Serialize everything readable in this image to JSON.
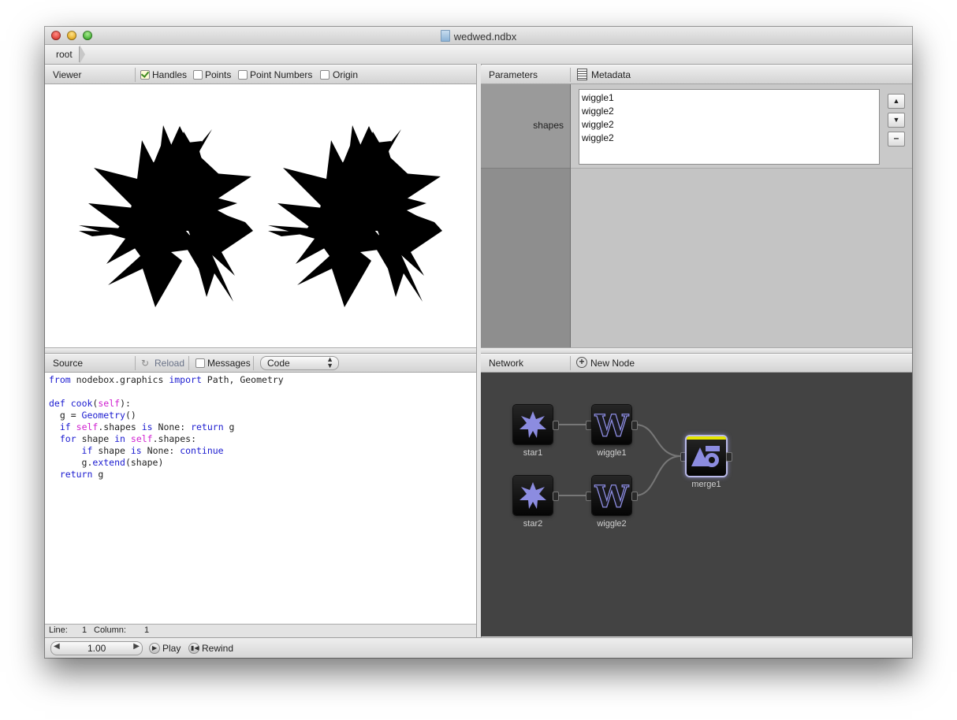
{
  "window": {
    "title": "wedwed.ndbx"
  },
  "breadcrumb": {
    "items": [
      "root"
    ]
  },
  "viewer": {
    "title": "Viewer",
    "options": [
      {
        "label": "Handles",
        "checked": true
      },
      {
        "label": "Points",
        "checked": false
      },
      {
        "label": "Point Numbers",
        "checked": false
      },
      {
        "label": "Origin",
        "checked": false
      }
    ]
  },
  "parameters": {
    "tab_parameters": "Parameters",
    "tab_metadata": "Metadata",
    "param_label": "shapes",
    "shapes": [
      "wiggle1",
      "wiggle2",
      "wiggle2",
      "wiggle2"
    ]
  },
  "source": {
    "title": "Source",
    "reload": "Reload",
    "messages": "Messages",
    "mode": "Code"
  },
  "statusbar": {
    "line_label": "Line:",
    "line": "1",
    "column_label": "Column:",
    "column": "1"
  },
  "network": {
    "title": "Network",
    "new_node": "New Node",
    "nodes": {
      "star1": "star1",
      "wiggle1": "wiggle1",
      "star2": "star2",
      "wiggle2": "wiggle2",
      "merge1": "merge1"
    }
  },
  "playback": {
    "frame": "1.00",
    "play": "Play",
    "rewind": "Rewind"
  },
  "colors": {
    "network_bg": "#434343",
    "node_icon": "#8c8ce0",
    "selected_bar": "#e6e600"
  }
}
